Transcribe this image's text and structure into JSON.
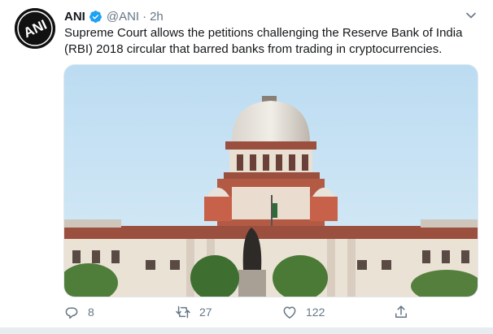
{
  "tweet": {
    "author_name": "ANI",
    "handle": "@ANI",
    "separator": "·",
    "time": "2h",
    "text": "Supreme Court allows the petitions challenging the Reserve Bank of India (RBI) 2018 circular that barred banks from trading in cryptocurrencies.",
    "avatar_text": "ANI",
    "media_description": "",
    "actions": {
      "replies": "8",
      "retweets": "27",
      "likes": "122"
    },
    "colors": {
      "verified": "#1da1f2",
      "muted": "#657786",
      "text": "#14171a"
    },
    "icons": [
      "verified-badge-icon",
      "caret-down-icon",
      "reply-icon",
      "retweet-icon",
      "like-icon",
      "share-icon"
    ]
  }
}
